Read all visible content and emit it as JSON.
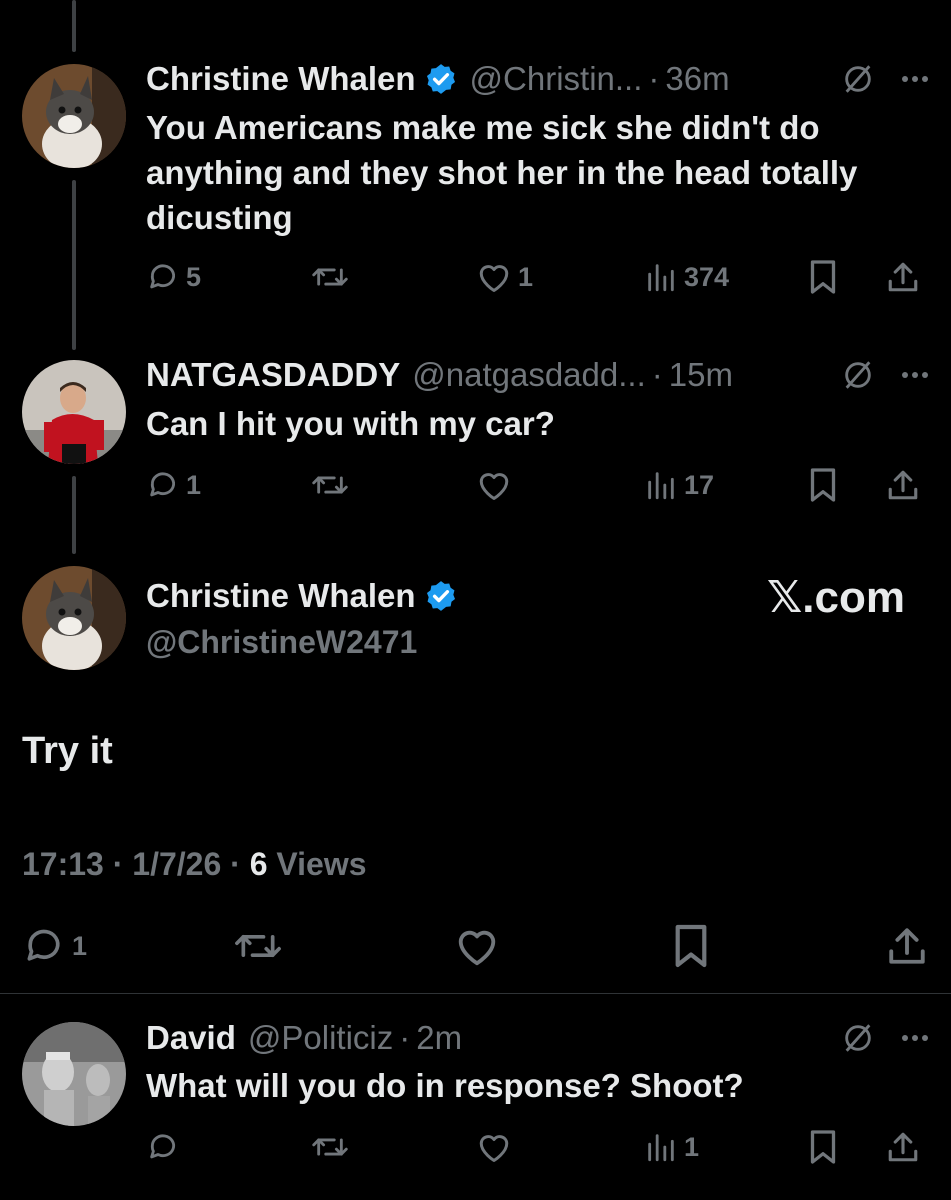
{
  "posts": [
    {
      "name": "Christine Whalen",
      "verified": true,
      "handle": "@Christin...",
      "time": "36m",
      "text": "You Americans make me sick she didn't do anything and they shot her in the head totally dicusting",
      "replies": "5",
      "likes": "1",
      "views": "374",
      "avatar": "cat-photo"
    },
    {
      "name": "NATGASDADDY",
      "handle": "@natgasdadd...",
      "time": "15m",
      "text": "Can I hit you with my car?",
      "replies": "1",
      "views": "17",
      "avatar": "footballer-photo"
    }
  ],
  "main_post": {
    "name": "Christine Whalen",
    "verified": true,
    "handle": "@ChristineW2471",
    "text": "Try it",
    "time": "17:13",
    "date": "1/7/26",
    "views_count": "6",
    "views_label": "Views",
    "replies": "1"
  },
  "watermark": "𝕏.com",
  "reply": {
    "name": "David",
    "handle": "@Politiciz",
    "time": "2m",
    "text": "What will you do in response? Shoot?",
    "views": "1",
    "avatar": "cyberman-photo"
  },
  "separator": "·",
  "colors": {
    "background": "#000000",
    "text": "#e7e9ea",
    "muted": "#71767b",
    "verified": "#1d9bf0"
  },
  "icons": [
    "reply-icon",
    "repost-icon",
    "like-icon",
    "views-icon",
    "bookmark-icon",
    "share-icon",
    "grok-icon",
    "more-icon",
    "verified-badge-icon"
  ]
}
